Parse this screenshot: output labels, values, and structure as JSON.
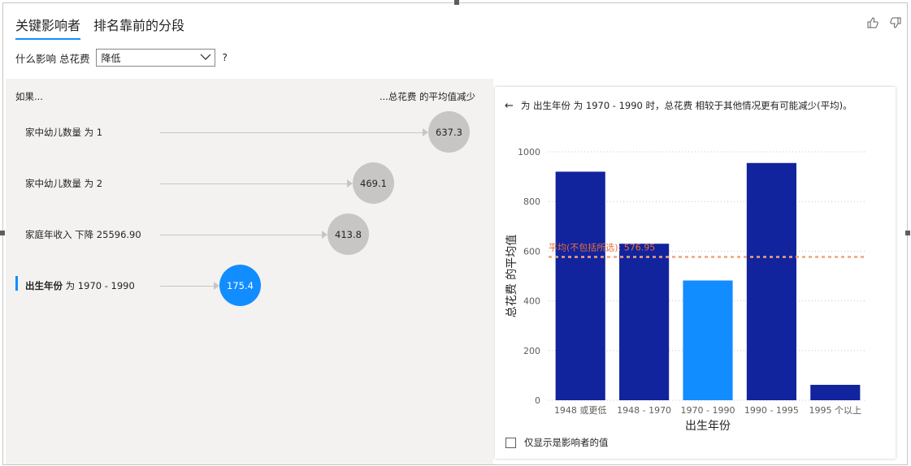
{
  "tabs": [
    {
      "label": "关键影响者",
      "active": true
    },
    {
      "label": "排名靠前的分段",
      "active": false
    }
  ],
  "filter": {
    "prefix": "什么影响 总花费",
    "dropdown_value": "降低",
    "help": "?"
  },
  "icons": {
    "thumbs_up": "thumbs-up-icon",
    "thumbs_down": "thumbs-down-icon",
    "back": "back-arrow-icon",
    "chevron": "chevron-down-icon"
  },
  "left": {
    "header_left": "如果...",
    "header_right": "...总花费 的平均值减少",
    "influencers": [
      {
        "label": "家中幼儿数量 为 1",
        "value": "637.3",
        "magnitude": 637.3,
        "selected": false
      },
      {
        "label": "家中幼儿数量 为 2",
        "value": "469.1",
        "magnitude": 469.1,
        "selected": false
      },
      {
        "label": "家庭年收入 下降 25596.90",
        "value": "413.8",
        "magnitude": 413.8,
        "selected": false
      },
      {
        "label_field": "出生年份",
        "label_op": " 为 1970 - 1990",
        "value": "175.4",
        "magnitude": 175.4,
        "selected": true
      }
    ]
  },
  "right": {
    "title": "为 出生年份 为 1970 - 1990 时，总花费 相较于其他情况更有可能减少(平均)。",
    "checkbox_label": "仅显示是影响者的值"
  },
  "colors": {
    "accent": "#118dff",
    "bar_dark": "#12239e",
    "avg_line": "#f2a27a",
    "avg_text": "#e8703a"
  },
  "chart_data": {
    "type": "bar",
    "categories": [
      "1948 或更低",
      "1948 - 1970",
      "1970 - 1990",
      "1990 - 1995",
      "1995 个以上"
    ],
    "values": [
      920,
      630,
      482,
      955,
      62
    ],
    "highlighted_category": "1970 - 1990",
    "xlabel": "出生年份",
    "ylabel": "总花费 的平均值",
    "ylim": [
      0,
      1000
    ],
    "yticks": [
      0,
      200,
      400,
      600,
      800,
      1000
    ],
    "reference_line": {
      "label": "平均(不包括所选): 576.95",
      "value": 576.95
    },
    "grid": true
  }
}
